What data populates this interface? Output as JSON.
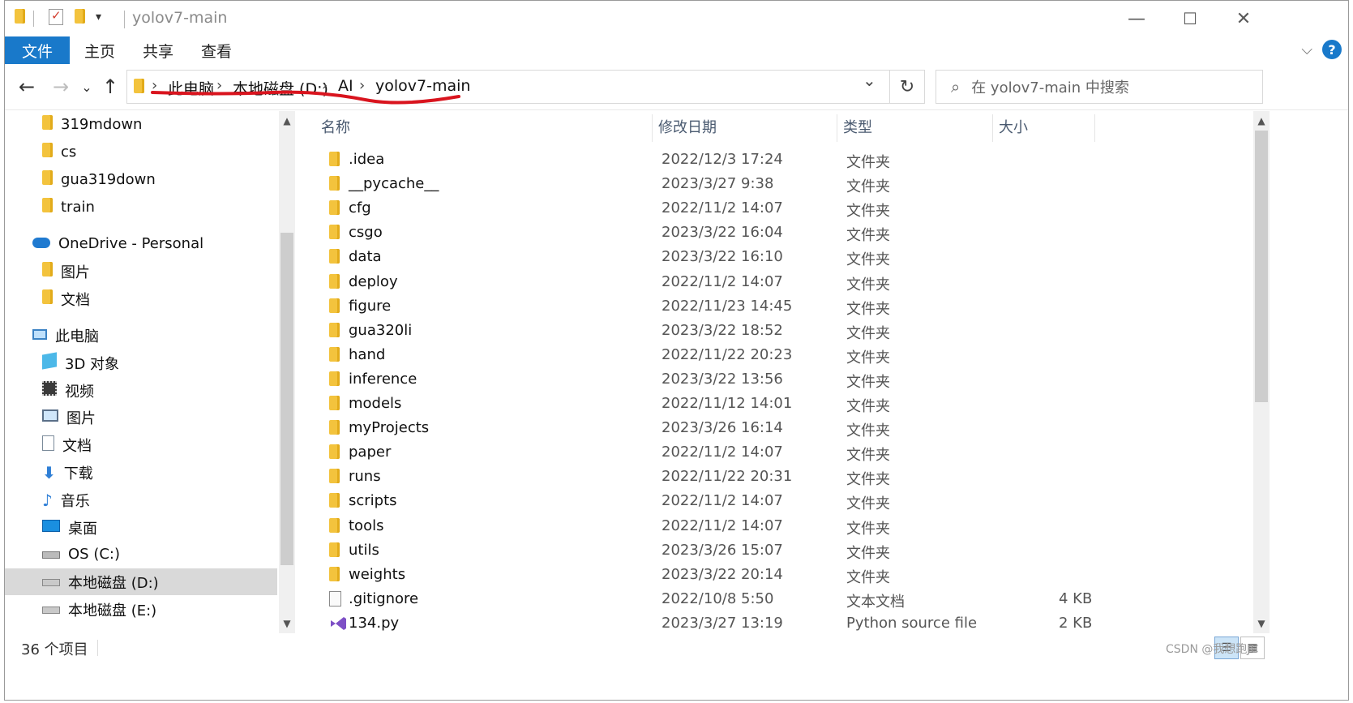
{
  "window": {
    "title": "yolov7-main",
    "minimize": "—",
    "maximize": "☐",
    "close": "✕"
  },
  "ribbon": {
    "tabs": [
      "文件",
      "主页",
      "共享",
      "查看"
    ],
    "help": "?"
  },
  "nav": {
    "back": "←",
    "forward": "→",
    "recent": "⌄",
    "up": "↑",
    "breadcrumb": [
      "此电脑",
      "本地磁盘 (D:)",
      "AI",
      "yolov7-main"
    ],
    "refresh": "↻",
    "search_placeholder": "在 yolov7-main 中搜索"
  },
  "sidebar": {
    "items": [
      {
        "label": "319mdown",
        "icon": "folder-icon",
        "indent": 2
      },
      {
        "label": "cs",
        "icon": "folder-icon",
        "indent": 2
      },
      {
        "label": "gua319down",
        "icon": "folder-icon",
        "indent": 2
      },
      {
        "label": "train",
        "icon": "folder-icon",
        "indent": 2
      },
      {
        "label": "OneDrive - Personal",
        "icon": "onedrive-cloud-icon",
        "indent": 1
      },
      {
        "label": "图片",
        "icon": "folder-icon",
        "indent": 2
      },
      {
        "label": "文档",
        "icon": "folder-icon",
        "indent": 2
      },
      {
        "label": "此电脑",
        "icon": "computer-icon",
        "indent": 1
      },
      {
        "label": "3D 对象",
        "icon": "3d-objects-icon",
        "indent": 2
      },
      {
        "label": "视频",
        "icon": "video-icon",
        "indent": 2
      },
      {
        "label": "图片",
        "icon": "pictures-icon",
        "indent": 2
      },
      {
        "label": "文档",
        "icon": "documents-icon",
        "indent": 2
      },
      {
        "label": "下载",
        "icon": "download-icon",
        "indent": 2
      },
      {
        "label": "音乐",
        "icon": "music-icon",
        "indent": 2
      },
      {
        "label": "桌面",
        "icon": "desktop-icon",
        "indent": 2
      },
      {
        "label": "OS (C:)",
        "icon": "drive-c-icon",
        "indent": 2
      },
      {
        "label": "本地磁盘 (D:)",
        "icon": "drive-icon",
        "indent": 2,
        "selected": true
      },
      {
        "label": "本地磁盘 (E:)",
        "icon": "drive-icon",
        "indent": 2
      }
    ]
  },
  "columns": {
    "name": "名称",
    "date": "修改日期",
    "type": "类型",
    "size": "大小"
  },
  "files": [
    {
      "name": ".idea",
      "date": "2022/12/3 17:24",
      "type": "文件夹",
      "size": "",
      "icon": "folder-icon"
    },
    {
      "name": "__pycache__",
      "date": "2023/3/27 9:38",
      "type": "文件夹",
      "size": "",
      "icon": "folder-icon"
    },
    {
      "name": "cfg",
      "date": "2022/11/2 14:07",
      "type": "文件夹",
      "size": "",
      "icon": "folder-icon"
    },
    {
      "name": "csgo",
      "date": "2023/3/22 16:04",
      "type": "文件夹",
      "size": "",
      "icon": "folder-icon"
    },
    {
      "name": "data",
      "date": "2023/3/22 16:10",
      "type": "文件夹",
      "size": "",
      "icon": "folder-icon"
    },
    {
      "name": "deploy",
      "date": "2022/11/2 14:07",
      "type": "文件夹",
      "size": "",
      "icon": "folder-icon"
    },
    {
      "name": "figure",
      "date": "2022/11/23 14:45",
      "type": "文件夹",
      "size": "",
      "icon": "folder-icon"
    },
    {
      "name": "gua320li",
      "date": "2023/3/22 18:52",
      "type": "文件夹",
      "size": "",
      "icon": "folder-icon"
    },
    {
      "name": "hand",
      "date": "2022/11/22 20:23",
      "type": "文件夹",
      "size": "",
      "icon": "folder-icon"
    },
    {
      "name": "inference",
      "date": "2023/3/22 13:56",
      "type": "文件夹",
      "size": "",
      "icon": "folder-icon"
    },
    {
      "name": "models",
      "date": "2022/11/12 14:01",
      "type": "文件夹",
      "size": "",
      "icon": "folder-icon"
    },
    {
      "name": "myProjects",
      "date": "2023/3/26 16:14",
      "type": "文件夹",
      "size": "",
      "icon": "folder-icon"
    },
    {
      "name": "paper",
      "date": "2022/11/2 14:07",
      "type": "文件夹",
      "size": "",
      "icon": "folder-icon"
    },
    {
      "name": "runs",
      "date": "2022/11/22 20:31",
      "type": "文件夹",
      "size": "",
      "icon": "folder-icon"
    },
    {
      "name": "scripts",
      "date": "2022/11/2 14:07",
      "type": "文件夹",
      "size": "",
      "icon": "folder-icon"
    },
    {
      "name": "tools",
      "date": "2022/11/2 14:07",
      "type": "文件夹",
      "size": "",
      "icon": "folder-icon"
    },
    {
      "name": "utils",
      "date": "2023/3/26 15:07",
      "type": "文件夹",
      "size": "",
      "icon": "folder-icon"
    },
    {
      "name": "weights",
      "date": "2023/3/22 20:14",
      "type": "文件夹",
      "size": "",
      "icon": "folder-icon"
    },
    {
      "name": ".gitignore",
      "date": "2022/10/8 5:50",
      "type": "文本文档",
      "size": "4 KB",
      "icon": "text-file-icon"
    },
    {
      "name": "134.py",
      "date": "2023/3/27 13:19",
      "type": "Python source file",
      "size": "2 KB",
      "icon": "python-file-icon"
    }
  ],
  "status": {
    "count": "36 个项目"
  },
  "watermark": "CSDN @我想跑JC",
  "colors": {
    "accent": "#1979ca",
    "folder": "#f3c33d",
    "annotation_underline": "#d9141e",
    "selected_row": "#d9d9d9"
  }
}
